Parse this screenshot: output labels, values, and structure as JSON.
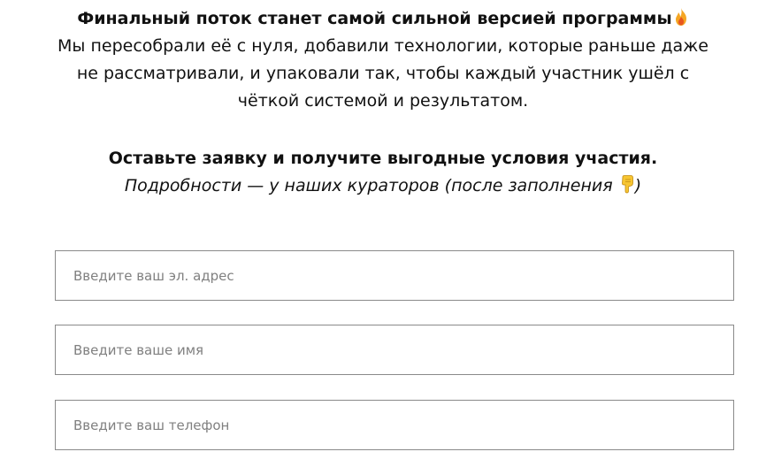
{
  "intro": {
    "headline": "Финальный поток станет самой сильной версией программы",
    "headline_icon": "fire-icon",
    "body_lines": [
      "Мы пересобрали её с нуля, добавили технологии, которые раньше даже",
      "не рассматривали, и упаковали так, чтобы каждый участник ушёл с",
      "чёткой системой и результатом."
    ]
  },
  "cta": {
    "title": "Оставьте заявку и получите выгодные условия участия.",
    "subtitle_text": "Подробности — у наших кураторов (после заполнения",
    "subtitle_icon": "pointing-down-icon",
    "subtitle_end": ")"
  },
  "form": {
    "email_placeholder": "Введите ваш эл. адрес",
    "email_value": "",
    "name_placeholder": "Введите ваше имя",
    "name_value": "",
    "phone_placeholder": "Введите ваш телефон",
    "phone_value": ""
  },
  "colors": {
    "text": "#111111",
    "field_border": "#8a8a8a",
    "placeholder": "#808080",
    "fire": "#f5a623",
    "hand": "#f7c531"
  }
}
